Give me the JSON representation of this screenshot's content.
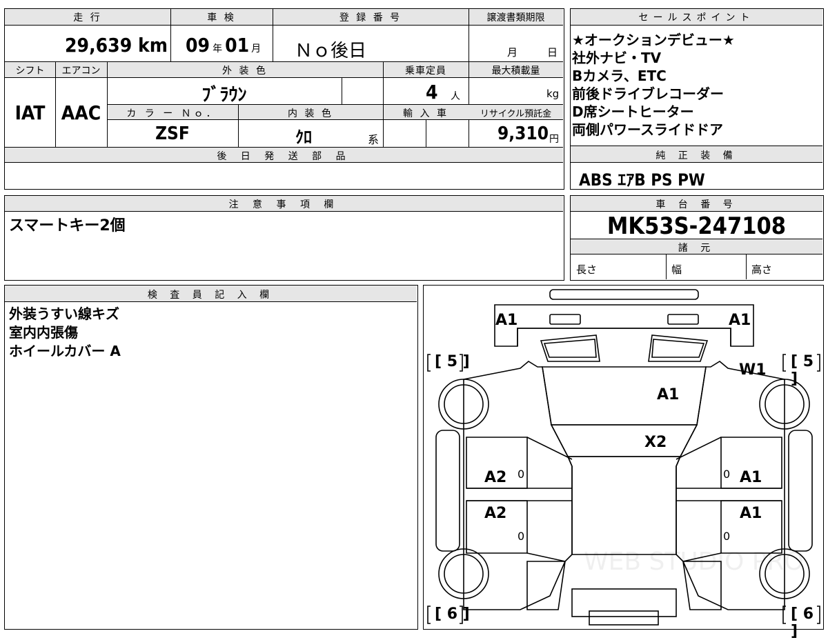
{
  "top": {
    "mileage_header": "走 行",
    "mileage_value": "29,639",
    "mileage_unit": "km",
    "inspection_header": "車 検",
    "inspection_year": "09",
    "inspection_year_unit": "年",
    "inspection_month": "01",
    "inspection_month_unit": "月",
    "registration_header": "登 録 番 号",
    "registration_value": "Ｎｏ後日",
    "transfer_header": "譲渡書類期限",
    "transfer_month_unit": "月",
    "transfer_day_unit": "日"
  },
  "row2": {
    "shift_header": "シフト",
    "aircon_header": "エアコン",
    "exterior_color_header": "外 装 色",
    "capacity_header": "乗車定員",
    "max_load_header": "最大積載量",
    "shift_value": "IAT",
    "aircon_value": "AAC",
    "exterior_color_value": "ﾌﾞﾗｳﾝ",
    "capacity_value": "4",
    "capacity_unit": "人",
    "max_load_unit": "kg",
    "color_no_header": "カ ラ ー Ｎｏ．",
    "interior_color_header": "内 装 色",
    "import_header": "輸 入 車",
    "recycle_header": "リサイクル預託金",
    "color_no_value": "ZSF",
    "interior_color_value": "ｸﾛ",
    "interior_color_suffix": "系",
    "recycle_value": "9,310",
    "recycle_unit": "円"
  },
  "later_parts": {
    "header": "後 日 発 送 部 品",
    "value": ""
  },
  "sales_points": {
    "header": "セールスポイント",
    "lines": [
      "★オークションデビュー★",
      "社外ナビ・TV",
      "Bカメラ、ETC",
      "前後ドライブレコーダー",
      "D席シートヒーター",
      "両側パワースライドドア"
    ]
  },
  "standard_equipment": {
    "header": "純 正 装 備",
    "value": "ABS ｴｱB PS PW"
  },
  "notes": {
    "header": "注 意 事 項 欄",
    "value": "スマートキー2個"
  },
  "chassis": {
    "header": "車 台 番 号",
    "value": "MK53S-247108"
  },
  "specs": {
    "header": "諸 元",
    "length": "長さ",
    "width": "幅",
    "height": "高さ"
  },
  "inspector": {
    "header": "検 査 員 記 入 欄",
    "lines": [
      "外装うすい線キズ",
      "室内内張傷",
      "ホイールカバー A"
    ]
  },
  "diagram": {
    "marks": {
      "front_left": "A1",
      "front_right": "A1",
      "left_front_bracket": "[ 5 ]",
      "right_front_bracket": "[ 5 ]",
      "windshield": "W1",
      "hood": "A1",
      "roof": "X2",
      "left_front_door": "A2",
      "right_front_door": "A1",
      "left_rear_door": "A2",
      "right_rear_door": "A1",
      "left_rear_bracket": "[ 6 ]",
      "right_rear_bracket": "[ 6 ]",
      "zero": "0"
    },
    "watermark": "WEB STUDIO PRO"
  }
}
